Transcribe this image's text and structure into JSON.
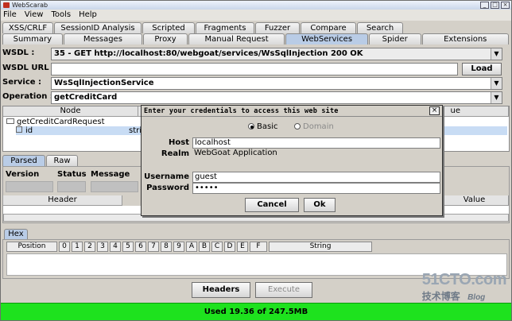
{
  "window": {
    "title": "WebScarab",
    "buttons": [
      "_",
      "□",
      "×"
    ]
  },
  "menu": [
    "File",
    "View",
    "Tools",
    "Help"
  ],
  "tabs_row1": [
    "XSS/CRLF",
    "SessionID Analysis",
    "Scripted",
    "Fragments",
    "Fuzzer",
    "Compare",
    "Search"
  ],
  "tabs_row2": [
    "Summary",
    "Messages",
    "Proxy",
    "Manual Request",
    "WebServices",
    "Spider",
    "Extensions"
  ],
  "active_tab": "WebServices",
  "form": {
    "wsdl_label": "WSDL :",
    "wsdl_value": "35 - GET http://localhost:80/webgoat/services/WsSqlInjection   200 OK",
    "wsdl_url_label": "WSDL URL :",
    "wsdl_url_value": "",
    "load_button": "Load",
    "service_label": "Service :",
    "service_value": "WsSqlInjectionService",
    "operation_label": "Operation :",
    "operation_value": "getCreditCard"
  },
  "table": {
    "headers": [
      "Node",
      "ue"
    ],
    "rows": [
      "getCreditCardRequest",
      "id",
      "stri"
    ]
  },
  "subtabs": [
    "Parsed",
    "Raw"
  ],
  "parsed_columns": [
    "Version",
    "Status",
    "Message"
  ],
  "header_value_columns": [
    "Header",
    "Value"
  ],
  "hex_tab": "Hex",
  "hex_columns": [
    "Position",
    "0",
    "1",
    "2",
    "3",
    "4",
    "5",
    "6",
    "7",
    "8",
    "9",
    "A",
    "B",
    "C",
    "D",
    "E",
    "F",
    "String"
  ],
  "bottom_buttons": {
    "headers": "Headers",
    "execute": "Execute"
  },
  "status": "Used 19.36 of 247.5MB",
  "dialog": {
    "title": "Enter your credentials to access this web site",
    "close": "×",
    "radio_basic": "Basic",
    "radio_domain": "Domain",
    "host_label": "Host",
    "host_value": "localhost",
    "realm_label": "Realm",
    "realm_value": "WebGoat Application",
    "username_label": "Username",
    "username_value": "guest",
    "password_label": "Password",
    "password_value": "•••••",
    "cancel": "Cancel",
    "ok": "Ok"
  },
  "watermark": {
    "site": "51CTO.com",
    "sub": "技术博客",
    "blog": "Blog"
  }
}
